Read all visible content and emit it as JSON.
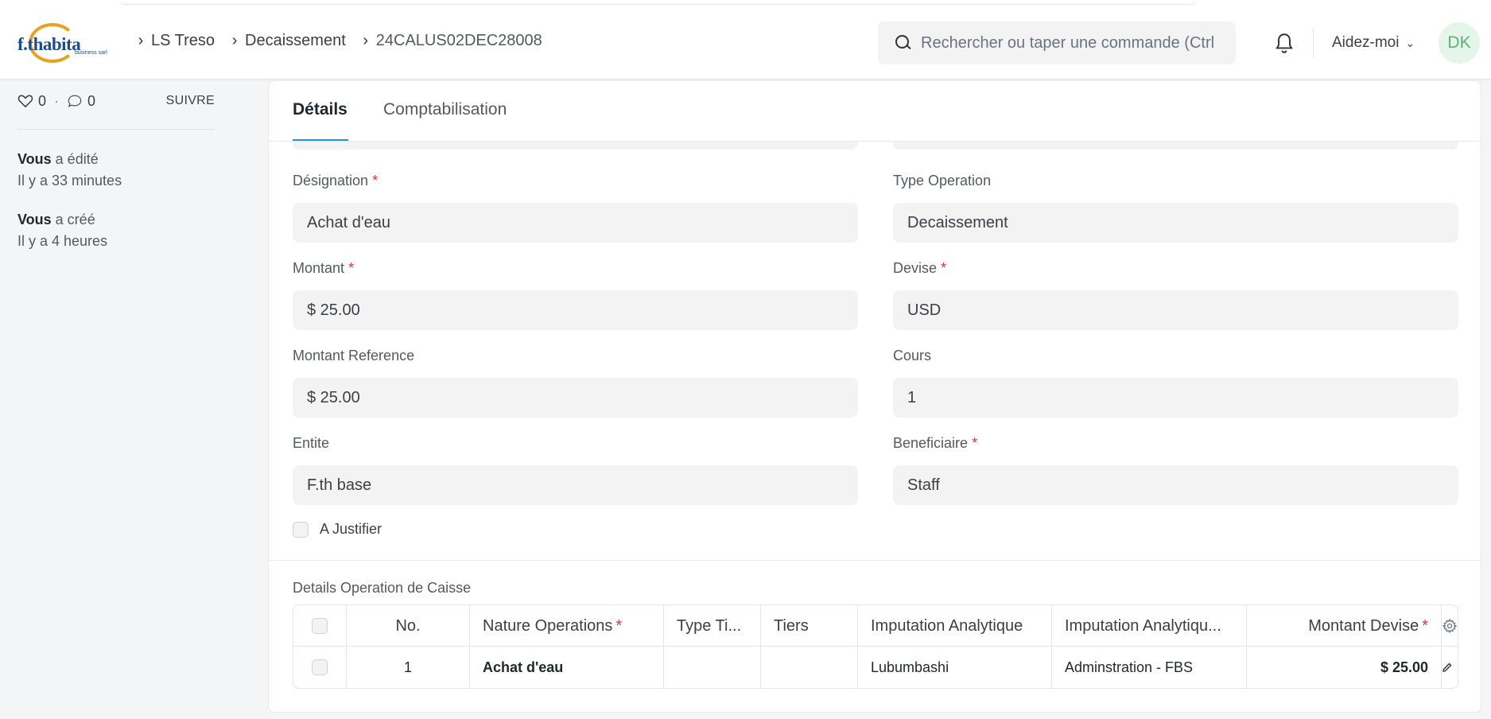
{
  "navbar": {
    "logo_text": "f.thabita",
    "logo_sub": "business sarl",
    "breadcrumbs": [
      "LS Treso",
      "Decaissement",
      "24CALUS02DEC28008"
    ],
    "search_placeholder": "Rechercher ou taper une commande (Ctrl",
    "help_label": "Aidez-moi",
    "avatar_initials": "DK"
  },
  "sidebar": {
    "likes_count": "0",
    "comments_count": "0",
    "follow_label": "SUIVRE",
    "activity": [
      {
        "who": "Vous",
        "action": " a édité",
        "when": "Il y a 33 minutes"
      },
      {
        "who": "Vous",
        "action": " a créé",
        "when": "Il y a 4 heures"
      }
    ]
  },
  "tabs": [
    {
      "label": "Détails",
      "active": true
    },
    {
      "label": "Comptabilisation",
      "active": false
    }
  ],
  "form": {
    "designation": {
      "label": "Désignation",
      "required": "*",
      "value": "Achat d'eau"
    },
    "type_operation": {
      "label": "Type Operation",
      "value": "Decaissement"
    },
    "montant": {
      "label": "Montant",
      "required": "*",
      "value": "$ 25.00"
    },
    "devise": {
      "label": "Devise",
      "required": "*",
      "value": "USD"
    },
    "montant_reference": {
      "label": "Montant Reference",
      "value": "$ 25.00"
    },
    "cours": {
      "label": "Cours",
      "value": "1"
    },
    "entite": {
      "label": "Entite",
      "value": "F.th base"
    },
    "beneficiaire": {
      "label": "Beneficiaire",
      "required": "*",
      "value": "Staff"
    },
    "a_justifier": {
      "label": "A Justifier"
    }
  },
  "table": {
    "title": "Details Operation de Caisse",
    "headers": {
      "no": "No.",
      "nature": "Nature Operations",
      "type_tiers": "Type Ti...",
      "tiers": "Tiers",
      "imputation1": "Imputation Analytique",
      "imputation2": "Imputation Analytiqu...",
      "montant_devise": "Montant Devise",
      "required": "*"
    },
    "rows": [
      {
        "no": "1",
        "nature": "Achat d'eau",
        "type_tiers": "",
        "tiers": "",
        "imputation1": "Lubumbashi",
        "imputation2": "Adminstration - FBS",
        "montant_devise": "$ 25.00",
        "edit_label": "modifier"
      }
    ]
  },
  "colors": {
    "accent": "#2490ef",
    "required": "#e03636",
    "avatar_bg": "#e4f5e9",
    "avatar_fg": "#5cb176"
  }
}
